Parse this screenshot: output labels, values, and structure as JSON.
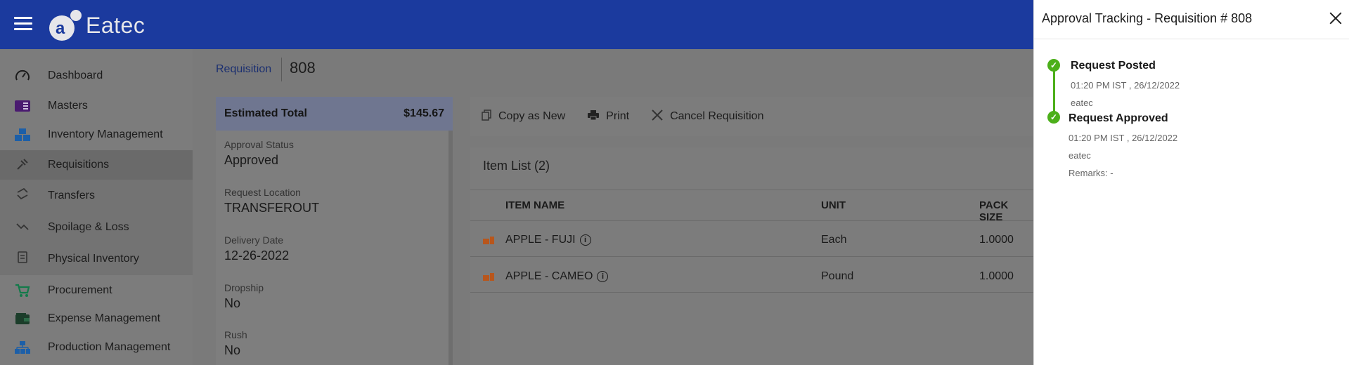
{
  "app": {
    "logo_letter": "a",
    "logo_text": "Eatec"
  },
  "sidebar": {
    "items": [
      {
        "label": "Dashboard",
        "icon": "gauge-icon"
      },
      {
        "label": "Masters",
        "icon": "book-icon"
      },
      {
        "label": "Inventory Management",
        "icon": "boxes-icon"
      },
      {
        "label": "Requisitions",
        "icon": "requisition-icon"
      },
      {
        "label": "Transfers",
        "icon": "transfer-icon"
      },
      {
        "label": "Spoilage & Loss",
        "icon": "spoilage-icon"
      },
      {
        "label": "Physical Inventory",
        "icon": "clipboard-icon"
      },
      {
        "label": "Procurement",
        "icon": "cart-icon"
      },
      {
        "label": "Expense Management",
        "icon": "wallet-icon"
      },
      {
        "label": "Production Management",
        "icon": "production-icon"
      }
    ]
  },
  "breadcrumb": {
    "link": "Requisition",
    "number": "808"
  },
  "summary": {
    "estimated_total_label": "Estimated Total",
    "estimated_total_value": "$145.67",
    "fields": [
      {
        "label": "Approval Status",
        "value": "Approved"
      },
      {
        "label": "Request Location",
        "value": "TRANSFEROUT"
      },
      {
        "label": "Delivery Date",
        "value": "12-26-2022"
      },
      {
        "label": "Dropship",
        "value": "No"
      },
      {
        "label": "Rush",
        "value": "No"
      }
    ]
  },
  "toolbar": {
    "copy_label": "Copy as New",
    "print_label": "Print",
    "cancel_label": "Cancel Requisition"
  },
  "item_list": {
    "title": "Item List (2)",
    "columns": [
      "ITEM NAME",
      "UNIT",
      "PACK SIZE"
    ],
    "rows": [
      {
        "name": "APPLE - FUJI",
        "unit": "Each",
        "pack_size": "1.0000"
      },
      {
        "name": "APPLE - CAMEO",
        "unit": "Pound",
        "pack_size": "1.0000"
      }
    ]
  },
  "panel": {
    "title": "Approval Tracking - Requisition # 808",
    "steps": [
      {
        "title": "Request Posted",
        "time": "01:20 PM IST , 26/12/2022",
        "user": "eatec"
      },
      {
        "title": "Request Approved",
        "time": "01:20 PM IST , 26/12/2022",
        "user": "eatec",
        "remarks": "Remarks: -"
      }
    ]
  },
  "colors": {
    "brand_blue": "#1b3a9e",
    "success_green": "#4caf1a",
    "item_icon": "#b8561c"
  }
}
